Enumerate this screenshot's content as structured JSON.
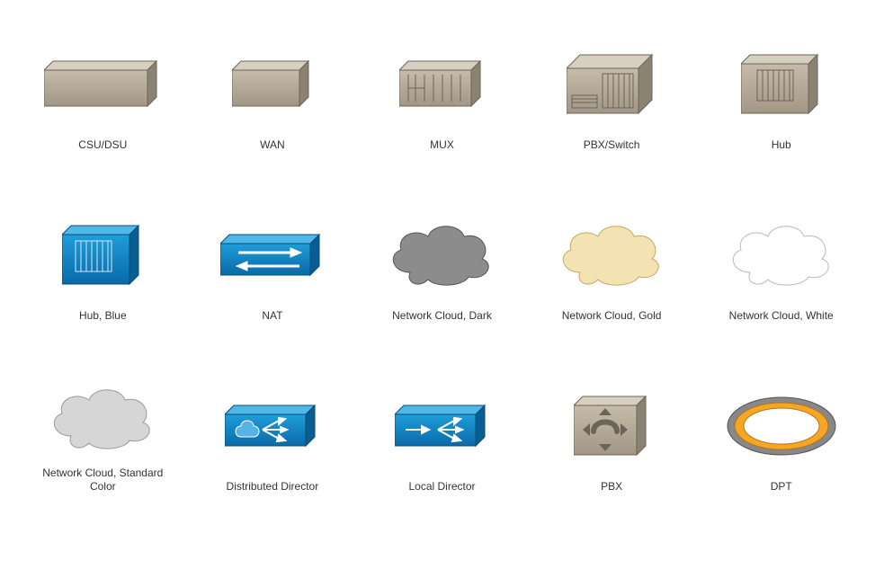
{
  "items": [
    {
      "label": "CSU/DSU"
    },
    {
      "label": "WAN"
    },
    {
      "label": "MUX"
    },
    {
      "label": "PBX/Switch"
    },
    {
      "label": "Hub"
    },
    {
      "label": "Hub, Blue"
    },
    {
      "label": "NAT"
    },
    {
      "label": "Network Cloud, Dark"
    },
    {
      "label": "Network Cloud, Gold"
    },
    {
      "label": "Network Cloud, White"
    },
    {
      "label": "Network Cloud, Standard Color"
    },
    {
      "label": "Distributed Director"
    },
    {
      "label": "Local Director"
    },
    {
      "label": "PBX"
    },
    {
      "label": "DPT"
    }
  ]
}
